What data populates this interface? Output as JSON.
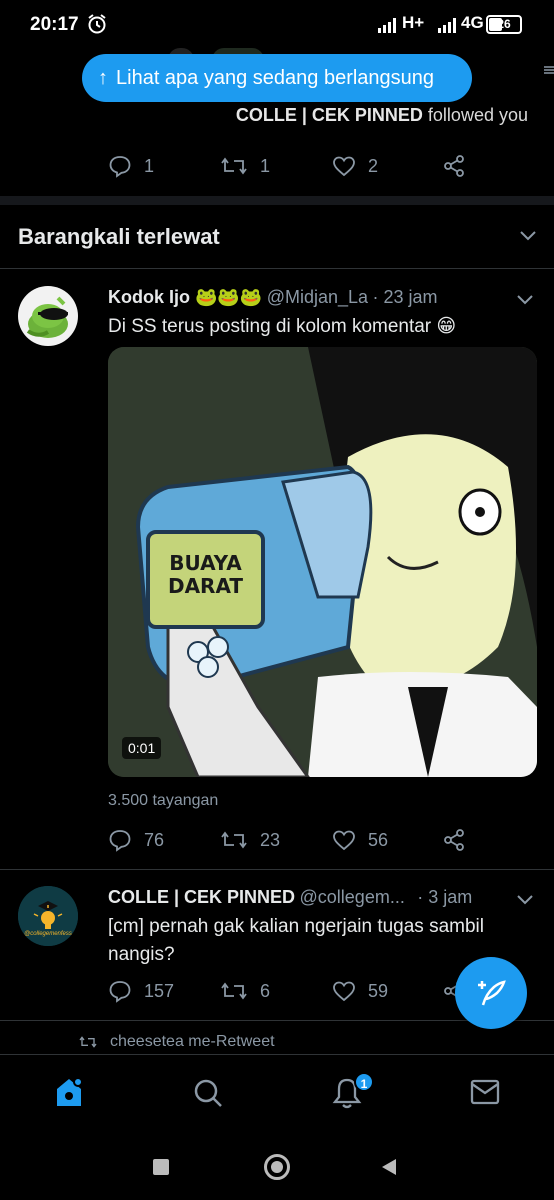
{
  "status_bar": {
    "time": "20:17",
    "network1": "H+",
    "network2": "4G",
    "battery": "26"
  },
  "new_tweets_pill": {
    "label": "Lihat apa yang sedang berlangsung"
  },
  "notification": {
    "user": "COLLE | CEK PINNED",
    "action": "followed you",
    "replies": "1",
    "retweets": "1",
    "likes": "2"
  },
  "section": {
    "title": "Barangkali terlewat"
  },
  "tweet1": {
    "name": "Kodok Ijo 🐸🐸🐸",
    "handle": "@Midjan_La",
    "time": "· 23 jam",
    "text": "Di SS terus posting di kolom komentar 😁",
    "media_text_line1": "BUAYA",
    "media_text_line2": "DARAT",
    "video_duration": "0:01",
    "views": "3.500 tayangan",
    "replies": "76",
    "retweets": "23",
    "likes": "56"
  },
  "tweet2": {
    "name": "COLLE | CEK PINNED",
    "handle": "@collegem...",
    "time": "· 3 jam",
    "text": "[cm] pernah gak kalian ngerjain tugas sambil nangis?",
    "avatar_text": "@collegemenfess",
    "replies": "157",
    "retweets": "6",
    "likes": "59"
  },
  "retweet_line": {
    "text": "cheesetea me-Retweet"
  },
  "bottom_nav": {
    "notification_count": "1"
  },
  "colors": {
    "accent": "#1d9bf0",
    "muted": "#8b98a5",
    "background": "#000000"
  }
}
